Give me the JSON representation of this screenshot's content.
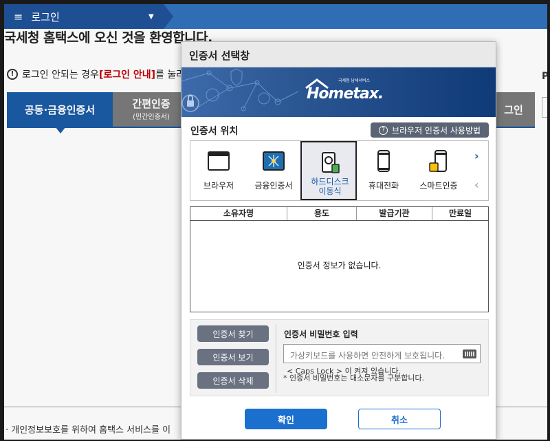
{
  "topbar": {
    "menu_label": "로그인",
    "hamburger": "≡",
    "caret": "▼"
  },
  "background": {
    "welcome": "국세청 홈택스에 오신 것을 환영합니다.",
    "notice_prefix": "로그인 안되는 경우 ",
    "notice_link": "[로그인 안내]",
    "notice_suffix": "를 눌러",
    "tabs": [
      {
        "label": "공동·금융인증서"
      },
      {
        "label": "간편인증",
        "sub": "(민간인증서)"
      },
      {
        "label": "그인"
      }
    ],
    "right_label": "P",
    "footer": "· 개인정보보호를 위하여 홈택스 서비스를 이"
  },
  "modal": {
    "title": "인증서 선택창",
    "logo_small": "국세청 납세서비스",
    "logo_text": "Hometax.",
    "location_title": "인증서 위치",
    "help_button": "브라우저 인증서 사용방법",
    "storage": [
      {
        "label": "브라우저",
        "icon": "browser-icon"
      },
      {
        "label": "금융인증서",
        "icon": "financial-cert-icon"
      },
      {
        "label": "하드디스크\n이동식",
        "icon": "harddisk-icon",
        "selected": true
      },
      {
        "label": "휴대전화",
        "icon": "phone-icon"
      },
      {
        "label": "스마트인증",
        "icon": "smart-cert-icon"
      }
    ],
    "table": {
      "headers": [
        "소유자명",
        "용도",
        "발급기관",
        "만료일"
      ],
      "empty": "인증서 정보가 없습니다."
    },
    "side_buttons": [
      "인증서 찾기",
      "인증서 보기",
      "인증서 삭제"
    ],
    "password": {
      "label": "인증서 비밀번호 입력",
      "placeholder": "가상키보드를 사용하면 안전하게 보호됩니다.",
      "caps": "< Caps Lock > 이 켜져 있습니다.",
      "hint": "* 인증서 비밀번호는 대소문자를 구분합니다."
    },
    "ok": "확인",
    "cancel": "취소"
  }
}
